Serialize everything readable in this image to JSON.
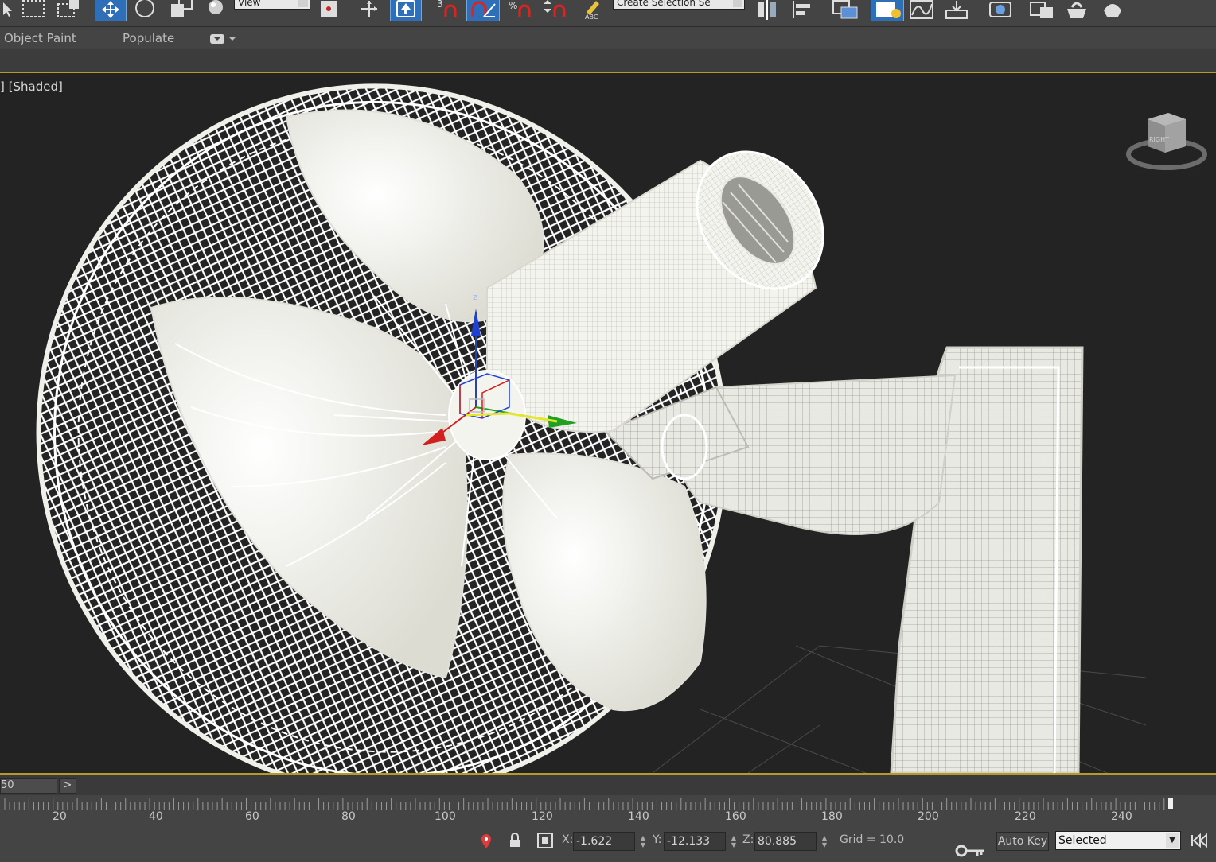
{
  "toolbar": {
    "ref_coord_dropdown": "View",
    "selection_set_dropdown": "Create Selection Se"
  },
  "ribbon": {
    "tabs": [
      "Object Paint",
      "Populate"
    ]
  },
  "viewport": {
    "label": "] [Shaded]",
    "viewcube_face": "RIGHT",
    "gizmo_axis": "z"
  },
  "timeline": {
    "frame_display": "50",
    "next_button": ">",
    "ruler_labels": [
      "20",
      "40",
      "60",
      "80",
      "100",
      "120",
      "140",
      "160",
      "180",
      "200",
      "220",
      "240"
    ]
  },
  "status": {
    "x_label": "X:",
    "x_value": "-1.622",
    "y_label": "Y:",
    "y_value": "-12.133",
    "z_label": "Z:",
    "z_value": "80.885",
    "grid": "Grid = 10.0",
    "auto_key": "Auto Key",
    "key_filter": "Selected"
  },
  "colors": {
    "accent_active": "#2f6fb8",
    "timeline_border": "#b59a2a",
    "viewport_bg": "#232323",
    "gizmo_x": "#d02020",
    "gizmo_y": "#20a020",
    "gizmo_z": "#2040d0"
  }
}
